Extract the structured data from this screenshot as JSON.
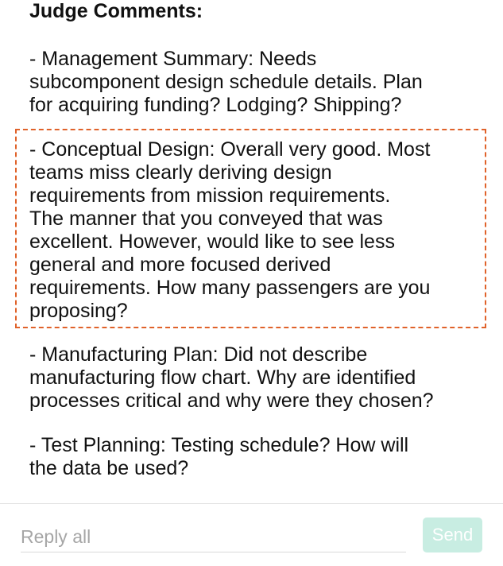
{
  "comments": {
    "heading": "Judge Comments:",
    "paragraphs": [
      "- Management Summary: Needs\nsubcomponent design schedule details.  Plan\nfor acquiring funding?  Lodging?  Shipping?",
      "- Conceptual Design: Overall very good.  Most\nteams miss clearly deriving design\nrequirements from mission requirements.\nThe manner that you conveyed that was\nexcellent.  However, would like to see less\ngeneral and more focused derived\nrequirements.  How many passengers are you\nproposing?",
      "- Manufacturing Plan: Did not describe\nmanufacturing flow chart.  Why are identified\nprocesses critical and why were they chosen?",
      "- Test Planning: Testing schedule?  How will\nthe data be used?"
    ]
  },
  "reply": {
    "placeholder": "Reply all",
    "value": "",
    "send_label": "Send"
  },
  "colors": {
    "highlight_border": "#e0622a",
    "send_button_bg": "#c8ede2"
  }
}
